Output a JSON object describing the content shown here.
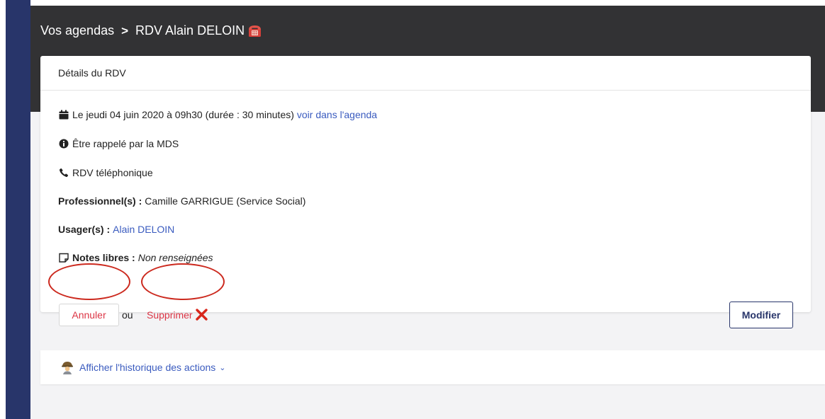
{
  "breadcrumb": {
    "root": "Vos agendas",
    "separator": ">",
    "current": "RDV Alain DELOIN",
    "badge_icon": "telephone-icon"
  },
  "card": {
    "title": "Détails du RDV",
    "datetime": "Le jeudi 04 juin 2020 à 09h30 (durée : 30 minutes)",
    "agenda_link": "voir dans l'agenda",
    "motif": "Être rappelé par la MDS",
    "lieu": "RDV téléphonique",
    "professionals_label": "Professionnel(s) :",
    "professionals_value": "Camille GARRIGUE (Service Social)",
    "users_label": "Usager(s) :",
    "users_value": "Alain DELOIN",
    "notes_label": "Notes libres :",
    "notes_value": "Non renseignées"
  },
  "actions": {
    "cancel": "Annuler",
    "or": "ou",
    "delete": "Supprimer",
    "edit": "Modifier"
  },
  "history": {
    "label": "Afficher l'historique des actions",
    "chevron": "⌄"
  },
  "colors": {
    "sidebar": "#28356a",
    "header": "#323234",
    "link": "#3a5bbf",
    "danger": "#dc3545",
    "annotation": "#cc2a1f"
  }
}
